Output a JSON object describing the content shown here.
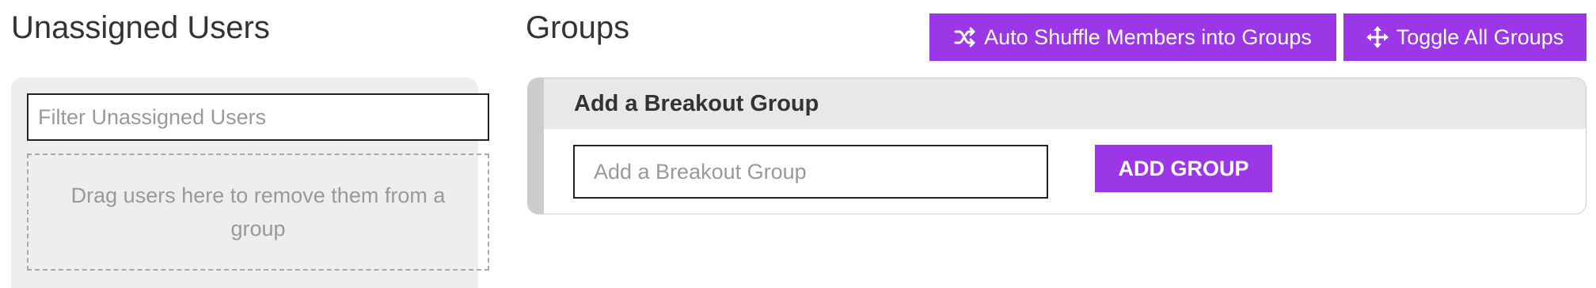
{
  "unassigned": {
    "title": "Unassigned Users",
    "filter_placeholder": "Filter Unassigned Users",
    "filter_value": "",
    "drop_zone_text": "Drag users here to remove them from a group"
  },
  "groups": {
    "title": "Groups",
    "shuffle_button": {
      "label": "Auto Shuffle Members into Groups",
      "icon": "shuffle-icon"
    },
    "toggle_button": {
      "label": "Toggle All Groups",
      "icon": "move-arrows-icon"
    },
    "add_group_card": {
      "header": "Add a Breakout Group",
      "input_placeholder": "Add a Breakout Group",
      "input_value": "",
      "button_label": "ADD GROUP"
    }
  },
  "colors": {
    "accent": "#9b37e6",
    "panel_bg": "#eeeeee",
    "card_header_bg": "#e8e8e8",
    "text": "#333333",
    "placeholder": "#999999"
  }
}
